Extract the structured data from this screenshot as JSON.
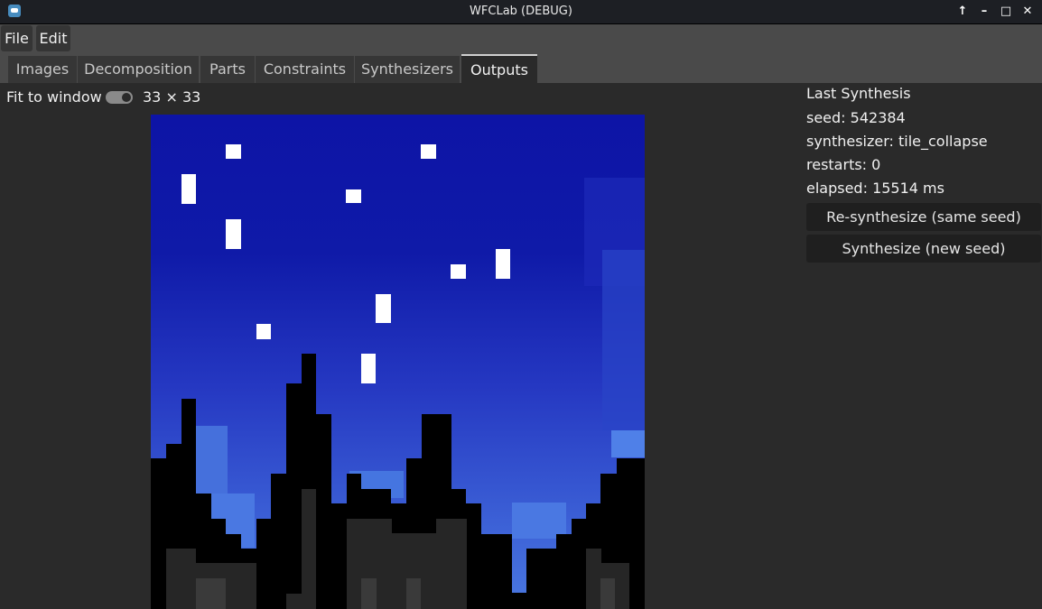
{
  "window": {
    "title": "WFCLab (DEBUG)"
  },
  "menu": {
    "file": "File",
    "edit": "Edit"
  },
  "tabs": [
    "Images",
    "Decomposition",
    "Parts",
    "Constraints",
    "Synthesizers",
    "Outputs"
  ],
  "active_tab": "Outputs",
  "toolbar": {
    "fit_label": "Fit to window",
    "fit_enabled": true,
    "dimensions": "33 × 33"
  },
  "panel": {
    "heading": "Last Synthesis",
    "seed": "seed: 542384",
    "synthesizer": "synthesizer: tile_collapse",
    "restarts": "restarts: 0",
    "elapsed": "elapsed: 15514 ms",
    "resynth_label": "Re-synthesize (same seed)",
    "synth_new_label": "Synthesize (new seed)"
  },
  "colors": {
    "sky_top": "#0d14a6",
    "sky_bottom": "#4a78e0",
    "silhouette": "#000000",
    "building_dark": "#262626",
    "window_gray": "#3a3a3a",
    "star": "#ffffff"
  }
}
